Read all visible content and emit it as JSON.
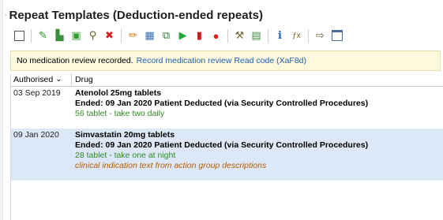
{
  "panel": {
    "title": "Repeat Templates (Deduction-ended repeats)",
    "title_marker": "▫"
  },
  "toolbar": {
    "buttons": [
      {
        "name": "select-all-checkbox-icon",
        "glyph": ""
      },
      {
        "name": "issue-prescription-icon",
        "glyph": "✎"
      },
      {
        "name": "amend-icon",
        "glyph": "▙"
      },
      {
        "name": "reauthorise-icon",
        "glyph": "▣"
      },
      {
        "name": "search-drug-icon",
        "glyph": "⚲"
      },
      {
        "name": "delete-icon",
        "glyph": "✖"
      },
      {
        "name": "edit-pencil-icon",
        "glyph": "✏"
      },
      {
        "name": "print-icon",
        "glyph": "▦"
      },
      {
        "name": "copy-icon",
        "glyph": "⧉"
      },
      {
        "name": "play-icon",
        "glyph": "▶"
      },
      {
        "name": "stop-icon",
        "glyph": "▮"
      },
      {
        "name": "record-icon",
        "glyph": "●"
      },
      {
        "name": "tools-icon",
        "glyph": "⚒"
      },
      {
        "name": "grid-icon",
        "glyph": "▤"
      },
      {
        "name": "info-icon",
        "glyph": "i"
      },
      {
        "name": "formula-icon",
        "glyph": "ƒx"
      },
      {
        "name": "export-icon",
        "glyph": "⇨"
      },
      {
        "name": "window-icon",
        "glyph": ""
      }
    ],
    "separators_after": [
      1,
      5,
      11,
      13,
      15
    ]
  },
  "notice": {
    "text": "No medication review recorded.",
    "link": "Record medication review Read code (XaF8d)"
  },
  "table": {
    "columns": {
      "authorised": "Authorised",
      "sort_icon": "⌄",
      "drug": "Drug"
    },
    "rows": [
      {
        "authorised": "03 Sep 2019",
        "drug": "Atenolol 25mg tablets",
        "ended": "Ended: 09 Jan 2020 Patient Deducted (via Security Controlled Procedures)",
        "quantity": "56 tablet - take two daily"
      },
      {
        "authorised": "09 Jan 2020",
        "drug": "Simvastatin 20mg tablets",
        "ended": "Ended: 09 Jan 2020 Patient Deducted (via Security Controlled Procedures)",
        "quantity": "28 tablet - take one at night",
        "indication": "clinical indication text from action group descriptions"
      }
    ]
  },
  "colors": {
    "selected_row": "#dce8f7",
    "notice_bg": "#fdf9dc",
    "link": "#1f5fb3",
    "quantity": "#2e8b22",
    "indication": "#b85c00"
  }
}
